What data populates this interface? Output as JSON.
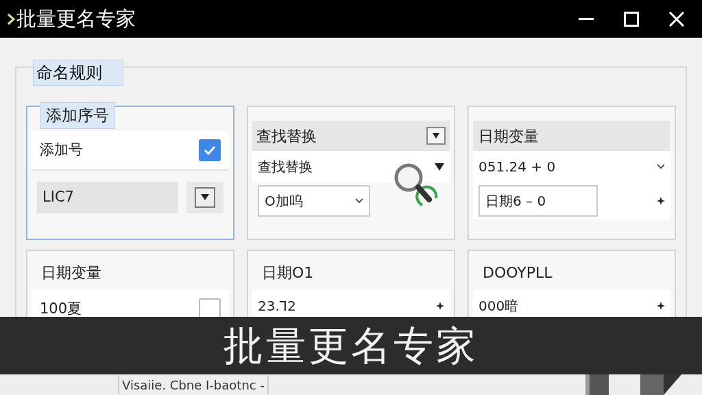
{
  "window": {
    "title": "批量更名专家"
  },
  "group": {
    "title": "命名规则"
  },
  "cards": [
    {
      "title": "添加序号",
      "kind": "tab",
      "selected": true,
      "rows": [
        {
          "kind": "checkbox",
          "label": "添加号",
          "checked": true
        },
        {
          "kind": "select",
          "label": "LIC7"
        }
      ]
    },
    {
      "title": "查找替换",
      "kind": "menu",
      "selected": false,
      "rows": [
        {
          "kind": "caret",
          "label": "查找替换"
        },
        {
          "kind": "combo",
          "label": "O加呜"
        }
      ]
    },
    {
      "title": "日期变量",
      "kind": "bar",
      "selected": false,
      "rows": [
        {
          "kind": "chevron",
          "label": "051.24 + 0"
        },
        {
          "kind": "input",
          "label": "日期6 – 0"
        }
      ]
    },
    {
      "title": "日期变量",
      "kind": "plain",
      "selected": false,
      "rows": [
        {
          "kind": "checkbox",
          "label": "100夏",
          "checked": false
        }
      ]
    },
    {
      "title": "日期O1",
      "kind": "plain",
      "selected": false,
      "rows": [
        {
          "kind": "plus",
          "label": "23.Ꞁ2"
        }
      ]
    },
    {
      "title": "DOOYPLL",
      "kind": "plain",
      "selected": false,
      "rows": [
        {
          "kind": "plus",
          "label": "000暗"
        }
      ]
    }
  ],
  "caption": "批量更名专家",
  "status_bar": {
    "text": "Visaiie. Cbne I-baotnc -"
  }
}
